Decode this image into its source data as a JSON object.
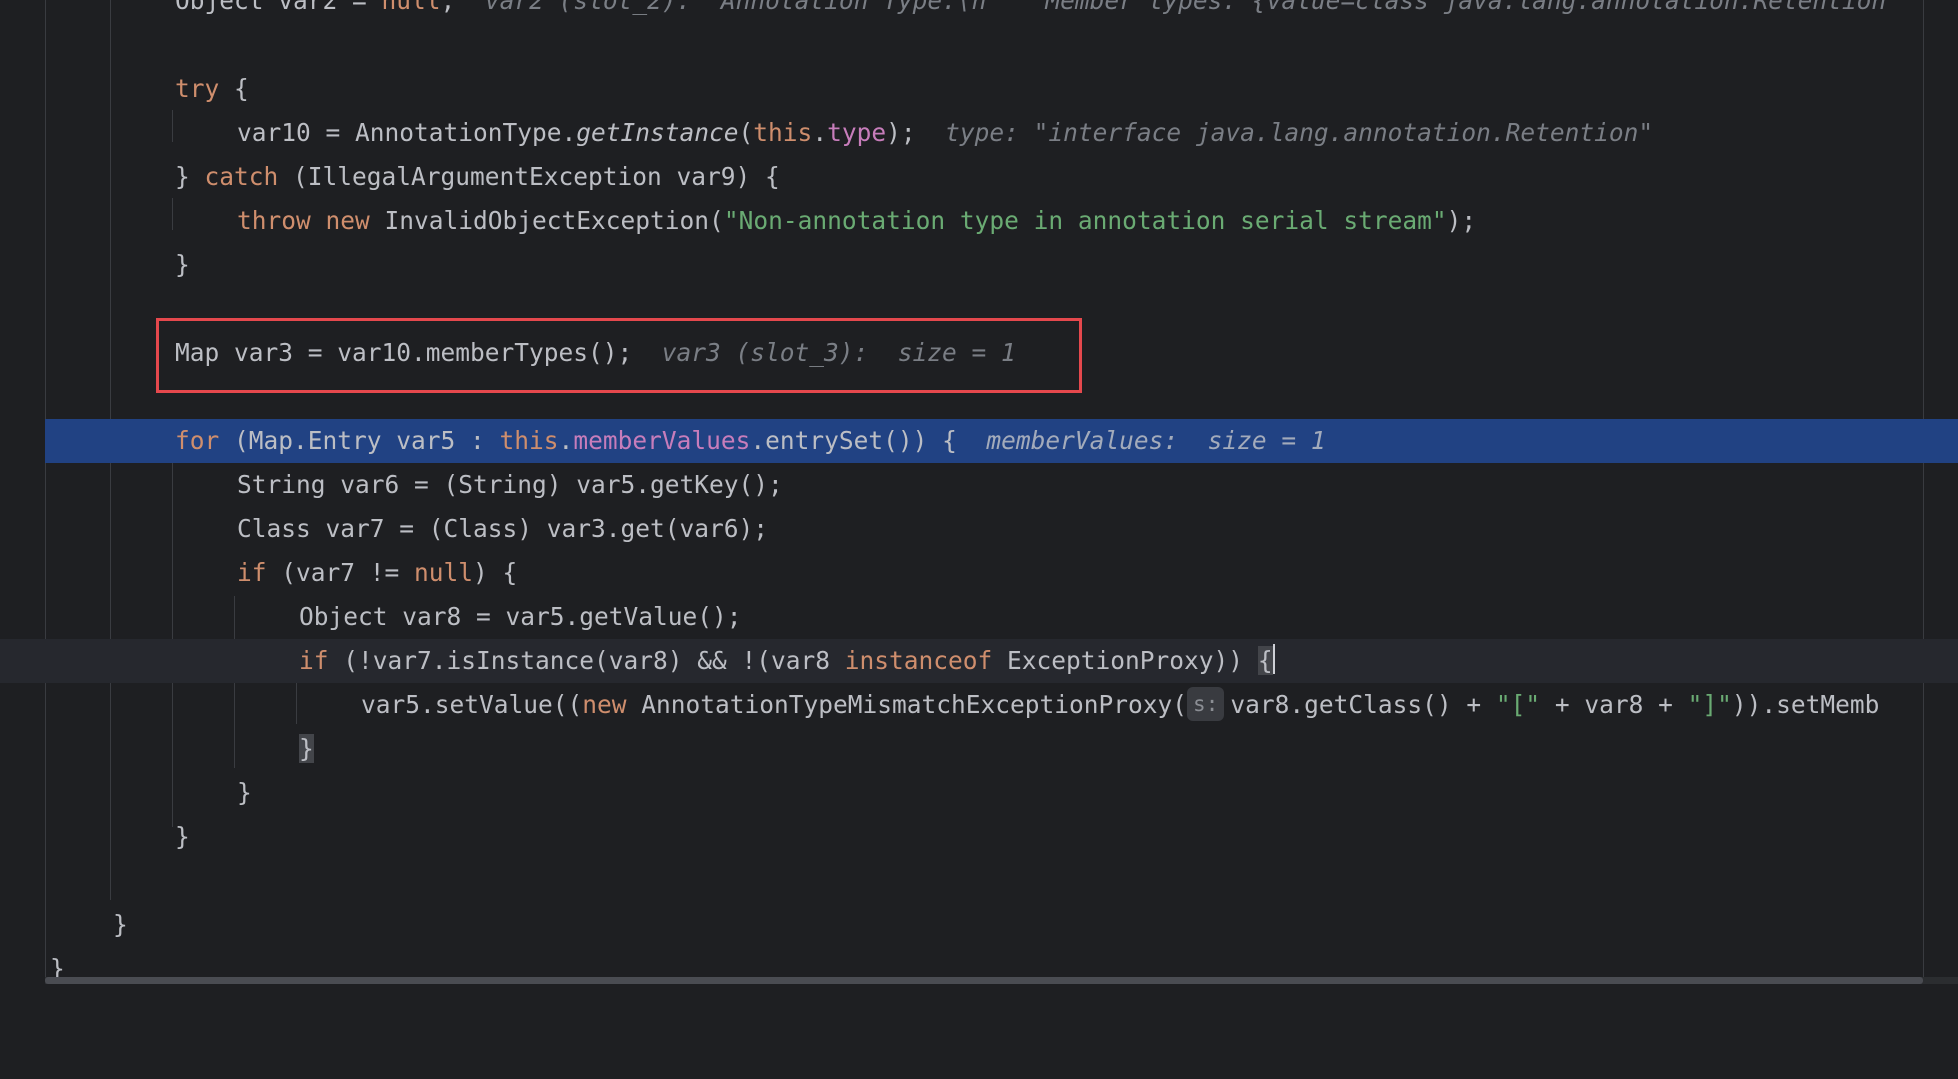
{
  "editor": {
    "lines": {
      "l1": {
        "a": "Object var2 = ",
        "b": "null",
        "c": ";",
        "hint": "var2 (slot_2): \"Annotation Type:\\n    Member types: {value=class java.lang.annotation.Retention"
      },
      "l2": {
        "kw": "try",
        "b": " {"
      },
      "l3": {
        "a": "var10 = AnnotationType.",
        "m": "getInstance",
        "b": "(",
        "kw": "this",
        "dot": ".",
        "fld": "type",
        "c": ");",
        "hint": "type: \"interface java.lang.annotation.Retention\""
      },
      "l4": {
        "a": "} ",
        "kw": "catch",
        "b": " (IllegalArgumentException var9) {"
      },
      "l5": {
        "kw1": "throw",
        "sp": " ",
        "kw2": "new",
        "a": " InvalidObjectException(",
        "str": "\"Non-annotation type in annotation serial stream\"",
        "b": ");"
      },
      "l6": {
        "a": "}"
      },
      "l7": {
        "a": "Map var3 = var10.memberTypes();",
        "hint": "var3 (slot_3):  size = 1"
      },
      "l8": {
        "kw": "for",
        "a": " (Map.Entry var5 : ",
        "kw2": "this",
        "dot": ".",
        "fld": "memberValues",
        "b": ".entrySet()) {",
        "hint": "memberValues:  size = 1"
      },
      "l9": {
        "a": "String var6 = (String) var5.getKey();"
      },
      "l10": {
        "a": "Class var7 = (Class) var3.get(var6);"
      },
      "l11": {
        "kw": "if",
        "a": " (var7 != ",
        "kw2": "null",
        "b": ") {"
      },
      "l12": {
        "a": "Object var8 = var5.getValue();"
      },
      "l13": {
        "kw": "if",
        "a": " (!var7.isInstance(var8) && !(var8 ",
        "kw2": "instanceof",
        "b": " ExceptionProxy)) ",
        "brace": "{"
      },
      "l14": {
        "a": "var5.setValue((",
        "kw": "new",
        "b": " AnnotationTypeMismatchExceptionProxy(",
        "param": "s:",
        "c": "var8.getClass() + ",
        "s1": "\"[\"",
        "d": " + var8 + ",
        "s2": "\"]\"",
        "e": ")).setMemb"
      },
      "l15": {
        "brace": "}"
      },
      "l16": {
        "a": "}"
      },
      "l17": {
        "a": "}"
      },
      "l18": {
        "a": "}"
      },
      "l19": {
        "a": "}"
      }
    }
  },
  "colors": {
    "background": "#1e1f22",
    "keyword": "#cf8e6d",
    "string": "#6aab73",
    "field": "#c77dbb",
    "execution_line": "#214283",
    "annotation_box": "#e5484d"
  }
}
